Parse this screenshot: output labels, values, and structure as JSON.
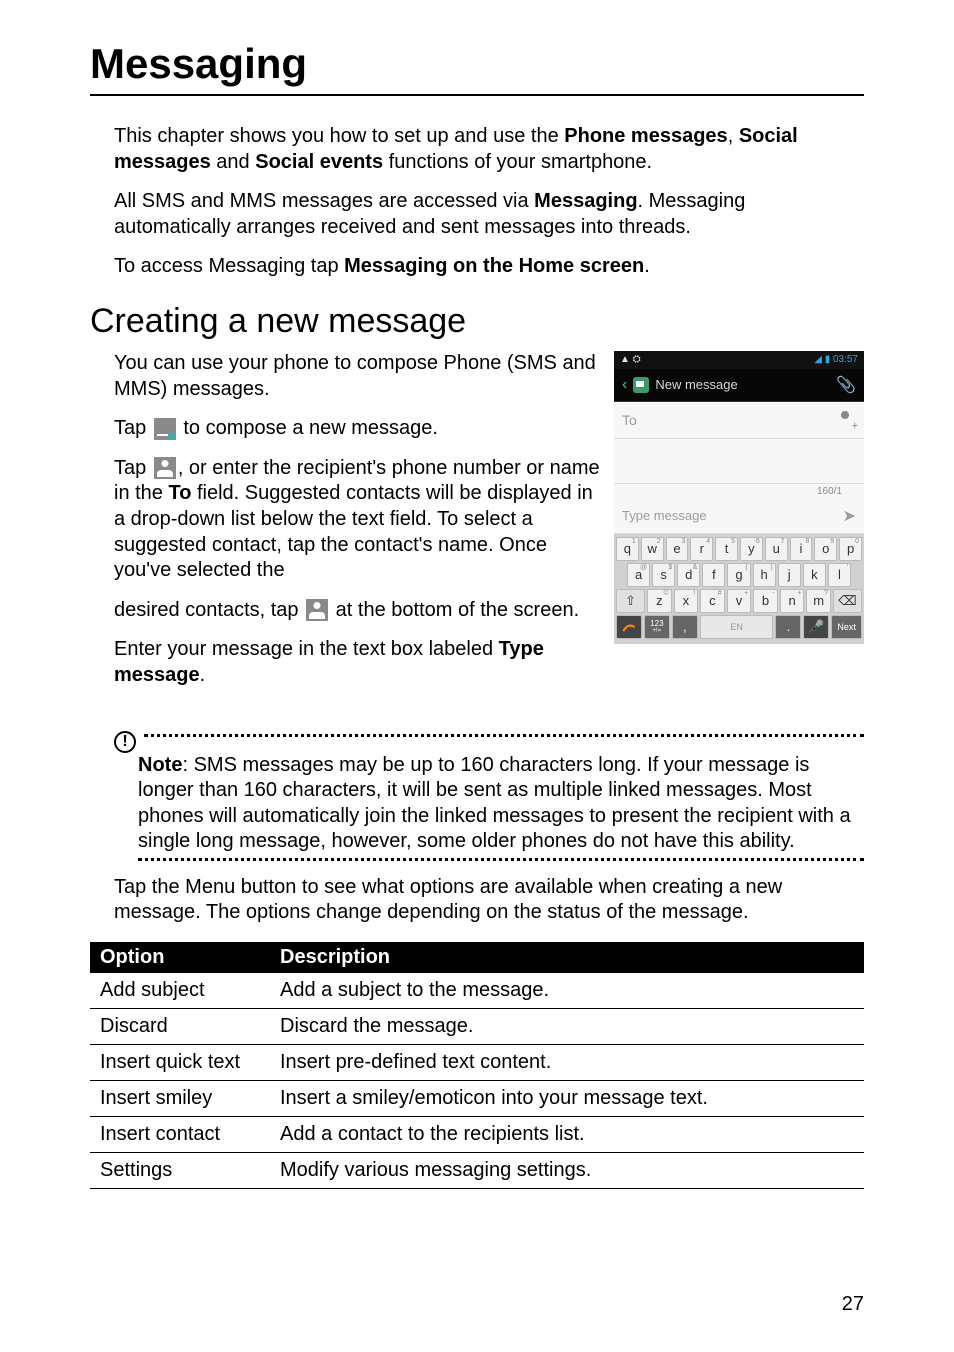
{
  "title": "Messaging",
  "intro": {
    "p1_a": "This chapter shows you how to set up and use the ",
    "phone_messages": "Phone messages",
    "comma1": ", ",
    "social_messages": "Social messages",
    "and": " and ",
    "social_events": "Social events",
    "p1_b": " functions of your smartphone.",
    "p2_a": "All SMS and MMS messages are accessed via ",
    "messaging_bold": "Messaging",
    "p2_b": ". Messaging automatically arranges received and sent messages into threads.",
    "p3_a": "To access Messaging tap ",
    "p3_bold": "Messaging on the Home screen",
    "p3_b": "."
  },
  "section1": {
    "heading": "Creating a new message",
    "p1": "You can use your phone to compose Phone (SMS and MMS) messages.",
    "p2_a": "Tap ",
    "p2_b": " to compose a new message.",
    "p3_a": "Tap ",
    "p3_b": ", or enter the recipient's phone number or name in the ",
    "to_bold": "To",
    "p3_c": " field. Suggested contacts will be displayed in a drop-down list below the text field. To select a suggested contact, tap the contact's name. Once you've selected the ",
    "p4_a": "desired contacts, tap ",
    "p4_b": " at the bottom of the screen.",
    "p5_a": "Enter your message in the text box labeled ",
    "type_message_bold": "Type message",
    "p5_b": "."
  },
  "note": {
    "label": "Note",
    "text": ": SMS messages may be up to 160 characters long. If your message is longer than 160 characters, it will be sent as multiple linked messages. Most phones will automatically join the linked messages to present the recipient with a single long message, however, some older phones do not have this ability."
  },
  "after_note": "Tap the Menu button to see what options are available when creating a new message. The options change depending on the status of the message.",
  "table": {
    "headers": {
      "option": "Option",
      "desc": "Description"
    },
    "rows": [
      {
        "option": "Add subject",
        "desc": "Add a subject to the message."
      },
      {
        "option": "Discard",
        "desc": "Discard the message."
      },
      {
        "option": "Insert quick text",
        "desc": "Insert pre-defined text content."
      },
      {
        "option": "Insert smiley",
        "desc": "Insert a smiley/emoticon into your message text."
      },
      {
        "option": "Insert contact",
        "desc": "Add a contact to the recipients list."
      },
      {
        "option": "Settings",
        "desc": "Modify various messaging settings."
      }
    ]
  },
  "page_number": "27",
  "phone": {
    "status": {
      "left_icons": "▲ ⛭",
      "right": "◢ ▮ 03:57"
    },
    "header": {
      "title": "New message"
    },
    "to": "To",
    "counter": "160/1",
    "type_placeholder": "Type message",
    "keyboard": {
      "row1": [
        {
          "m": "q",
          "s": "1"
        },
        {
          "m": "w",
          "s": "2"
        },
        {
          "m": "e",
          "s": "3"
        },
        {
          "m": "r",
          "s": "4"
        },
        {
          "m": "t",
          "s": "5"
        },
        {
          "m": "y",
          "s": "6"
        },
        {
          "m": "u",
          "s": "7"
        },
        {
          "m": "i",
          "s": "8"
        },
        {
          "m": "o",
          "s": "9"
        },
        {
          "m": "p",
          "s": "0"
        }
      ],
      "row2": [
        {
          "m": "a",
          "s": "@"
        },
        {
          "m": "s",
          "s": "$"
        },
        {
          "m": "d",
          "s": "&"
        },
        {
          "m": "f",
          "s": ""
        },
        {
          "m": "g",
          "s": "("
        },
        {
          "m": "h",
          "s": ")"
        },
        {
          "m": "j",
          "s": ""
        },
        {
          "m": "k",
          "s": ""
        },
        {
          "m": "l",
          "s": "'"
        }
      ],
      "shift": "⇧",
      "row3": [
        {
          "m": "z",
          "s": "©"
        },
        {
          "m": "x",
          "s": "!"
        },
        {
          "m": "c",
          "s": "#"
        },
        {
          "m": "v",
          "s": "+"
        },
        {
          "m": "b",
          "s": "-"
        },
        {
          "m": "n",
          "s": "+"
        },
        {
          "m": "m",
          "s": "?"
        }
      ],
      "bksp": "⌫",
      "num": "123",
      "sym": "+!=",
      "comma": ",",
      "space": "EN",
      "period": ".",
      "mic": "🎤",
      "next": "Next"
    }
  }
}
